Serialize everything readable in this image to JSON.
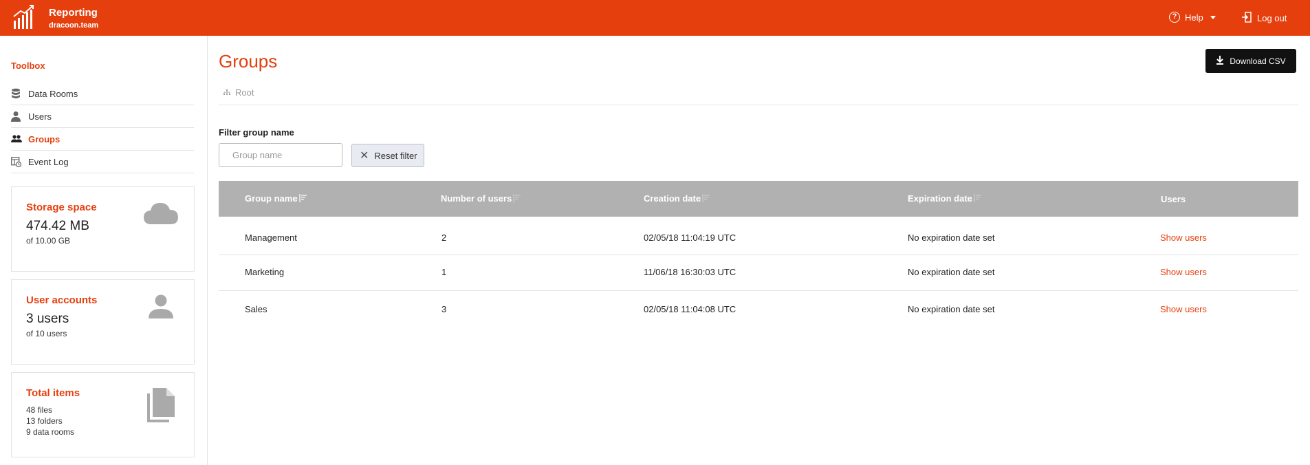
{
  "header": {
    "title": "Reporting",
    "subtitle": "dracoon.team",
    "help_label": "Help",
    "logout_label": "Log out"
  },
  "sidebar": {
    "section_title": "Toolbox",
    "items": [
      {
        "label": "Data Rooms",
        "icon": "database-icon"
      },
      {
        "label": "Users",
        "icon": "user-icon"
      },
      {
        "label": "Groups",
        "icon": "users-icon",
        "active": true
      },
      {
        "label": "Event Log",
        "icon": "event-log-icon"
      }
    ],
    "cards": {
      "storage": {
        "title": "Storage space",
        "value": "474.42 MB",
        "sub": "of 10.00 GB"
      },
      "accounts": {
        "title": "User accounts",
        "value": "3 users",
        "sub": "of 10 users"
      },
      "items": {
        "title": "Total items",
        "lines": [
          "48 files",
          "13 folders",
          "9 data rooms"
        ]
      }
    }
  },
  "main": {
    "title": "Groups",
    "download_label": "Download CSV",
    "breadcrumb": "Root",
    "filter": {
      "label": "Filter group name",
      "placeholder": "Group name",
      "value": "",
      "reset_label": "Reset filter"
    },
    "table": {
      "columns": [
        "Group name",
        "Number of users",
        "Creation date",
        "Expiration date",
        "Users"
      ],
      "rows": [
        {
          "name": "Management",
          "count": "2",
          "created": "02/05/18 11:04:19 UTC",
          "expires": "No expiration date set",
          "action": "Show users"
        },
        {
          "name": "Marketing",
          "count": "1",
          "created": "11/06/18 16:30:03 UTC",
          "expires": "No expiration date set",
          "action": "Show users"
        },
        {
          "name": "Sales",
          "count": "3",
          "created": "02/05/18 11:04:08 UTC",
          "expires": "No expiration date set",
          "action": "Show users"
        }
      ]
    }
  },
  "colors": {
    "brand": "#e53f0e",
    "table_header": "#b1b1b1",
    "button_dark": "#111111"
  }
}
